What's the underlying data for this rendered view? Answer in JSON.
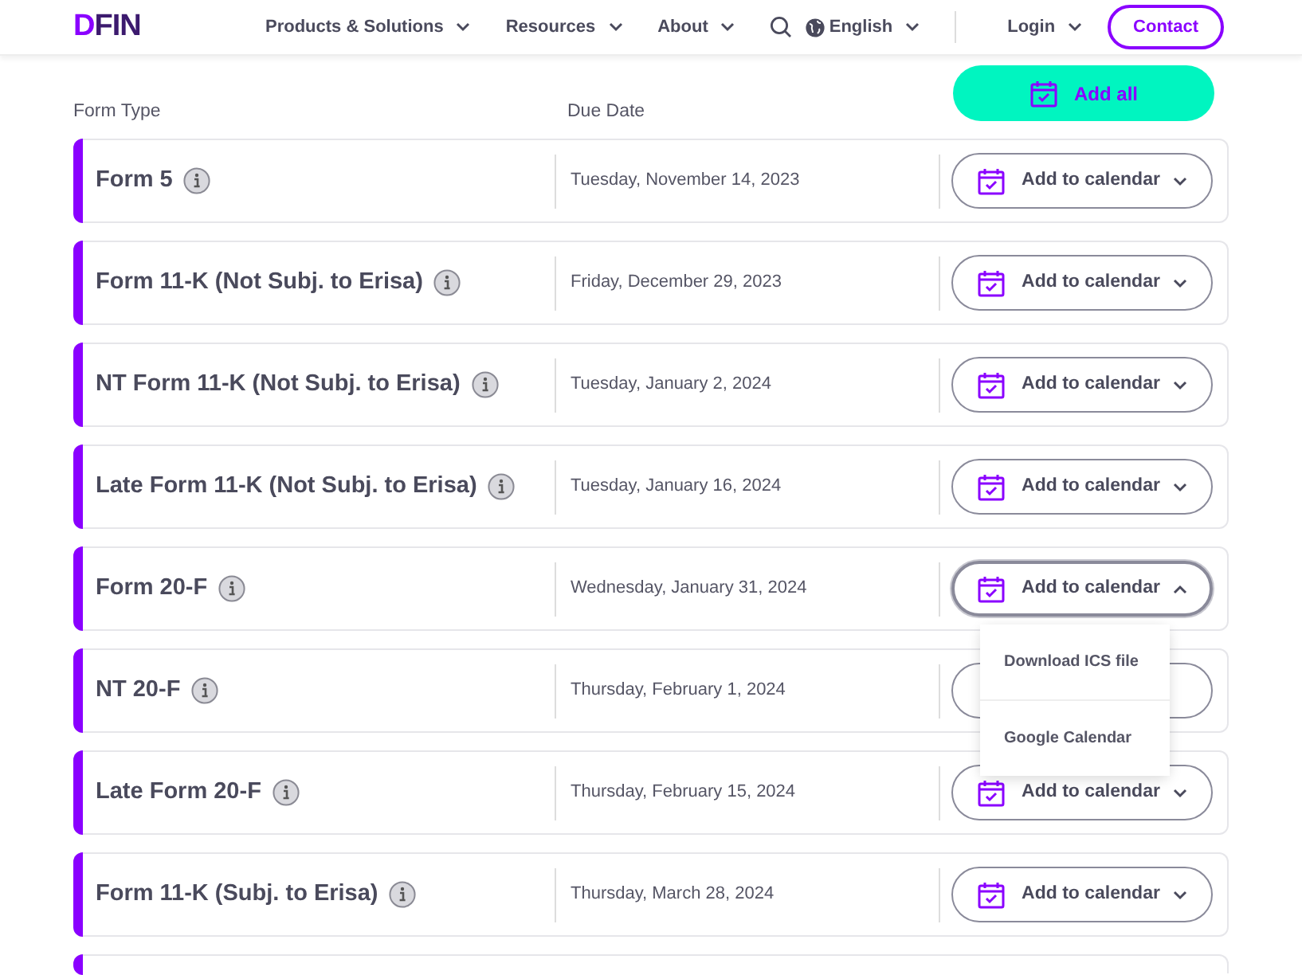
{
  "header": {
    "logo": "DFIN",
    "nav": [
      {
        "label": "Products & Solutions"
      },
      {
        "label": "Resources"
      },
      {
        "label": "About"
      }
    ],
    "language": "English",
    "login": "Login",
    "contact": "Contact"
  },
  "columns": {
    "form_type": "Form Type",
    "due_date": "Due Date"
  },
  "add_all": "Add all",
  "rows": [
    {
      "form": "Form 5",
      "date": "Tuesday, November 14, 2023",
      "button": "Add to calendar",
      "expanded": false
    },
    {
      "form": "Form 11-K (Not Subj. to Erisa)",
      "date": "Friday, December 29, 2023",
      "button": "Add to calendar",
      "expanded": false
    },
    {
      "form": "NT Form 11-K (Not Subj. to Erisa)",
      "date": "Tuesday, January 2, 2024",
      "button": "Add to calendar",
      "expanded": false
    },
    {
      "form": "Late Form 11-K (Not Subj. to Erisa)",
      "date": "Tuesday, January 16, 2024",
      "button": "Add to calendar",
      "expanded": false
    },
    {
      "form": "Form 20-F",
      "date": "Wednesday, January 31, 2024",
      "button": "Add to calendar",
      "expanded": true,
      "menu": [
        "Download ICS file",
        "Google Calendar"
      ]
    },
    {
      "form": "NT 20-F",
      "date": "Thursday, February 1, 2024",
      "expanded": false
    },
    {
      "form": "Late Form 20-F",
      "date": "Thursday, February 15, 2024",
      "button": "Add to calendar",
      "expanded": false
    },
    {
      "form": "Form 11-K (Subj. to Erisa)",
      "date": "Thursday, March 28, 2024",
      "button": "Add to calendar",
      "expanded": false
    }
  ]
}
